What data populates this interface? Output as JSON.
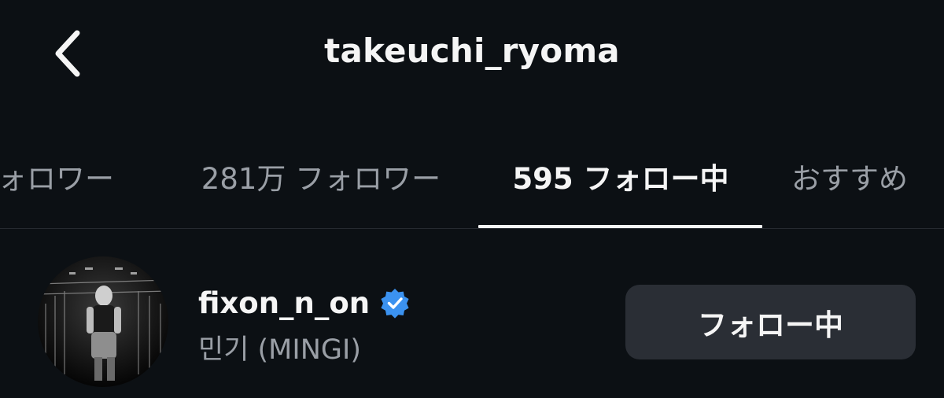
{
  "header": {
    "title": "takeuchi_ryoma",
    "back_icon": "chevron-left-icon"
  },
  "tabs": [
    {
      "label": "フォロワー",
      "active": false
    },
    {
      "label": "281万 フォロワー",
      "active": false
    },
    {
      "label": "595 フォロー中",
      "active": true
    },
    {
      "label": "おすすめ",
      "active": false
    }
  ],
  "list": [
    {
      "username": "fixon_n_on",
      "verified": true,
      "display_name": "민기 (MINGI)",
      "button_label": "フォロー中"
    }
  ],
  "colors": {
    "background": "#0c1014",
    "text_primary": "#f5f5f5",
    "text_secondary": "#9a9fa6",
    "button_bg": "#2a2e35",
    "verified_blue": "#3b92f0"
  }
}
